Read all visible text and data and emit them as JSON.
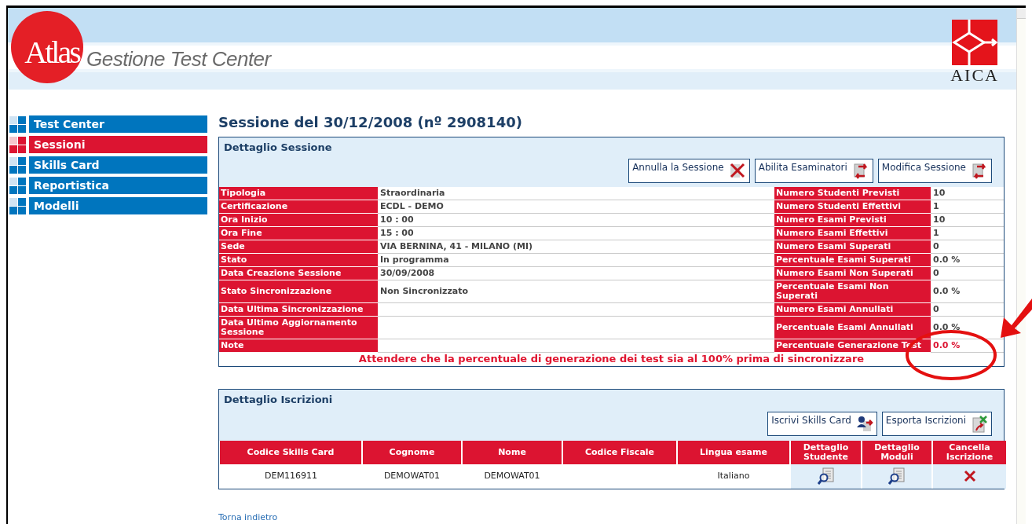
{
  "header": {
    "logo": "Atlas",
    "app_title": "Gestione Test Center",
    "partner_logo": "AICA"
  },
  "sidebar": {
    "items": [
      {
        "label": "Test Center",
        "selected": false
      },
      {
        "label": "Sessioni",
        "selected": true
      },
      {
        "label": "Skills Card",
        "selected": false
      },
      {
        "label": "Reportistica",
        "selected": false
      },
      {
        "label": "Modelli",
        "selected": false
      }
    ]
  },
  "page_title": "Sessione del 30/12/2008 (nº 2908140)",
  "session_panel": {
    "title": "Dettaglio Sessione",
    "buttons": [
      {
        "label": "Annulla la Sessione",
        "kind": "cross"
      },
      {
        "label": "Abilita Esaminatori",
        "kind": "swap"
      },
      {
        "label": "Modifica Sessione",
        "kind": "swap"
      }
    ],
    "rows": [
      {
        "label": "Tipologia",
        "value": "Straordinaria",
        "label_2": "Numero Studenti Previsti",
        "value_2": "10",
        "alert": false
      },
      {
        "label": "Certificazione",
        "value": "ECDL - DEMO",
        "label_2": "Numero Studenti Effettivi",
        "value_2": "1",
        "alert": false
      },
      {
        "label": "Ora Inizio",
        "value": "10 : 00",
        "label_2": "Numero Esami Previsti",
        "value_2": "10",
        "alert": false
      },
      {
        "label": "Ora Fine",
        "value": "15 : 00",
        "label_2": "Numero Esami Effettivi",
        "value_2": "1",
        "alert": false
      },
      {
        "label": "Sede",
        "value": "VIA BERNINA, 41 - MILANO (MI)",
        "label_2": "Numero Esami Superati",
        "value_2": "0",
        "alert": false
      },
      {
        "label": "Stato",
        "value": "In programma",
        "label_2": "Percentuale Esami Superati",
        "value_2": "0.0 %",
        "alert": false
      },
      {
        "label": "Data Creazione Sessione",
        "value": "30/09/2008",
        "label_2": "Numero Esami Non Superati",
        "value_2": "0",
        "alert": false
      },
      {
        "label": "Stato Sincronizzazione",
        "value": "Non Sincronizzato",
        "label_2": "Percentuale Esami Non Superati",
        "value_2": "0.0 %",
        "alert": false
      },
      {
        "label": "Data Ultima Sincronizzazione",
        "label_2": "Numero Esami Annullati",
        "value_2": "0",
        "alert": false
      },
      {
        "label": "Data Ultimo Aggiornamento Sessione",
        "label_2": "Percentuale Esami Annullati",
        "value_2": "0.0 %",
        "alert": false
      },
      {
        "label": "Note",
        "label_2": "Percentuale Generazione Test",
        "value_2": "0.0 %",
        "alert": true
      }
    ],
    "warning": "Attendere che la percentuale di generazione dei test sia al 100% prima di sincronizzare"
  },
  "enrollment_panel": {
    "title": "Dettaglio Iscrizioni",
    "buttons": [
      {
        "label": "Iscrivi Skills Card",
        "kind": "person"
      },
      {
        "label": "Esporta Iscrizioni",
        "kind": "export"
      }
    ],
    "columns": [
      "Codice Skills Card",
      "Cognome",
      "Nome",
      "Codice Fiscale",
      "Lingua esame",
      "Dettaglio Studente",
      "Dettaglio Moduli",
      "Cancella Iscrizione"
    ],
    "rows": [
      {
        "cells": [
          "DEM116911",
          "DEMOWAT01",
          "DEMOWAT01",
          "",
          "Italiano"
        ],
        "actions": [
          {
            "kind": "view"
          },
          {
            "kind": "view"
          },
          {
            "kind": "delete"
          }
        ]
      }
    ]
  },
  "back_link": "Torna indietro"
}
